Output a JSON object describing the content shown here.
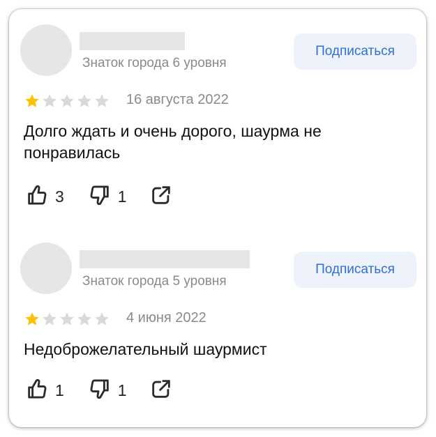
{
  "reviews": [
    {
      "level": "Знаток города 6 уровня",
      "subscribe_label": "Подписаться",
      "rating": 1,
      "date": "16 августа 2022",
      "text": "Долго ждать и очень дорого, шаурма не понравилась",
      "likes": "3",
      "dislikes": "1"
    },
    {
      "level": "Знаток города 5 уровня",
      "subscribe_label": "Подписаться",
      "rating": 1,
      "date": "4 июня 2022",
      "text": "Недоброжелательный шаурмист",
      "likes": "1",
      "dislikes": "1"
    }
  ],
  "colors": {
    "star_filled": "#fcc10a",
    "star_empty": "#d9d9d9",
    "accent": "#2f6fd6",
    "muted_text": "#8a8a8a"
  },
  "icons": {
    "like": "thumbs-up-icon",
    "dislike": "thumbs-down-icon",
    "share": "share-icon",
    "star": "star-icon"
  }
}
